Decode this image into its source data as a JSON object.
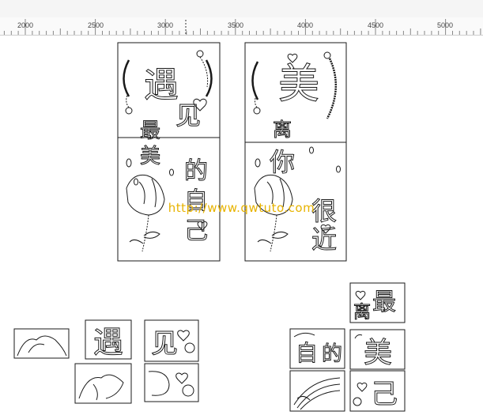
{
  "ruler": {
    "labels": [
      "2000",
      "2500",
      "3000",
      "3500",
      "4000",
      "4500",
      "5000"
    ]
  },
  "watermark": {
    "text": "http://www.qwtuto.com"
  },
  "design_left": {
    "chars": [
      "遇",
      "见",
      "最",
      "美",
      "的",
      "自",
      "己"
    ]
  },
  "design_right": {
    "chars": [
      "美",
      "离",
      "你",
      "很",
      "近"
    ]
  },
  "pieces_right": {
    "chars": [
      "最",
      "离",
      "美",
      "自",
      "的",
      "己"
    ]
  },
  "pieces_left": {
    "chars": [
      "遇",
      "见"
    ]
  },
  "colors": {
    "ink": "#1a1a1a",
    "watermark": "#e7b300",
    "ruler_bg": "#fafafa"
  },
  "icons": [
    "heart-icon",
    "rose-icon",
    "petal-icon",
    "leaf-icon"
  ]
}
